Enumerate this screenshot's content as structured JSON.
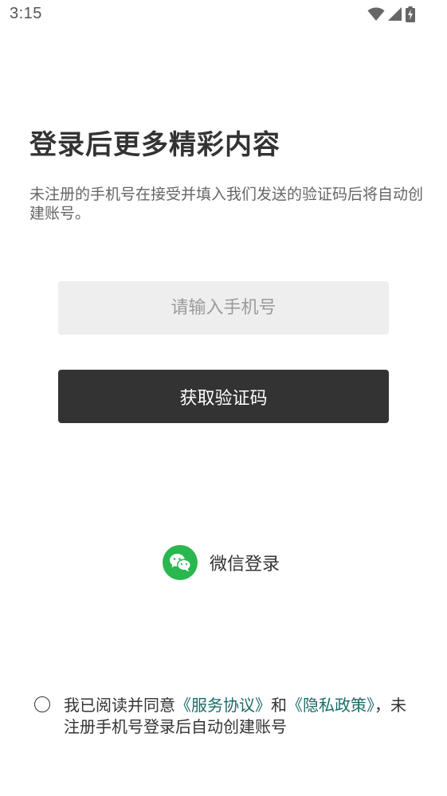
{
  "status_bar": {
    "time": "3:15",
    "icons": [
      "wifi-icon",
      "cell-signal-icon",
      "battery-charging-icon"
    ]
  },
  "login": {
    "title": "登录后更多精彩内容",
    "subtitle": "未注册的手机号在接受并填入我们发送的验证码后将自动创建账号。",
    "phone_input": {
      "value": "",
      "placeholder": "请输入手机号"
    },
    "get_code_label": "获取验证码",
    "wechat": {
      "label": "微信登录",
      "icon": "wechat-icon",
      "color": "#2ab74f"
    }
  },
  "agreement": {
    "checked": false,
    "prefix": "我已阅读并同意",
    "service_link": "《服务协议》",
    "connector": "和",
    "privacy_link": "《隐私政策》",
    "suffix": "，未注册手机号登录后自动创建账号",
    "link_color": "#1b6b67"
  },
  "colors": {
    "primary_button": "#333333",
    "input_background": "#eeeeee",
    "text": "#333333",
    "subtext": "#666666"
  }
}
